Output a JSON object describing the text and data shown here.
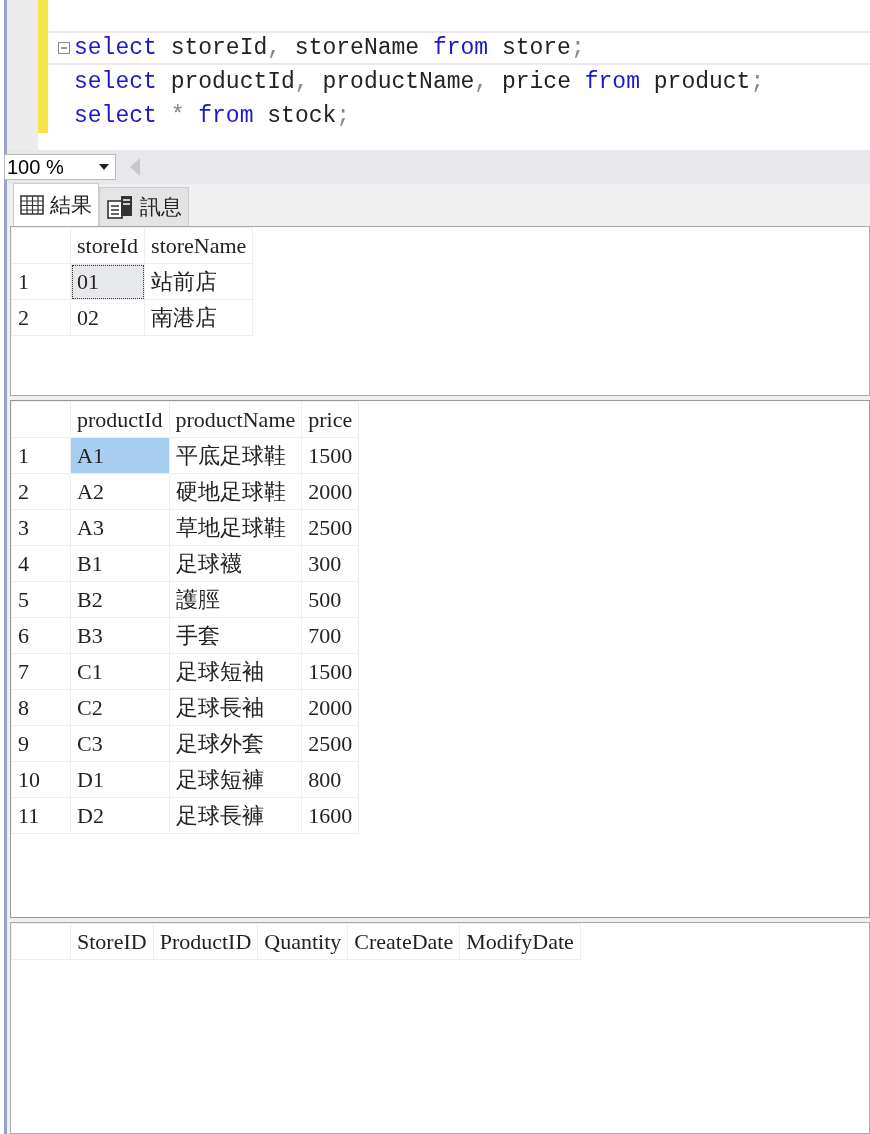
{
  "editor": {
    "lines": [
      [
        {
          "text": "select",
          "kind": "keyword"
        },
        {
          "text": " storeId",
          "kind": "ident"
        },
        {
          "text": ",",
          "kind": "punct"
        },
        {
          "text": " storeName ",
          "kind": "ident"
        },
        {
          "text": "from",
          "kind": "keyword"
        },
        {
          "text": " store",
          "kind": "ident"
        },
        {
          "text": ";",
          "kind": "punct"
        }
      ],
      [
        {
          "text": "select",
          "kind": "keyword"
        },
        {
          "text": " productId",
          "kind": "ident"
        },
        {
          "text": ",",
          "kind": "punct"
        },
        {
          "text": " productName",
          "kind": "ident"
        },
        {
          "text": ",",
          "kind": "punct"
        },
        {
          "text": " price ",
          "kind": "ident"
        },
        {
          "text": "from",
          "kind": "keyword"
        },
        {
          "text": " product",
          "kind": "ident"
        },
        {
          "text": ";",
          "kind": "punct"
        }
      ],
      [
        {
          "text": "select",
          "kind": "keyword"
        },
        {
          "text": " * ",
          "kind": "punct"
        },
        {
          "text": "from",
          "kind": "keyword"
        },
        {
          "text": " stock",
          "kind": "ident"
        },
        {
          "text": ";",
          "kind": "punct"
        }
      ]
    ]
  },
  "zoom": {
    "value": "100 %"
  },
  "tabs": [
    {
      "label": "結果",
      "selected": true
    },
    {
      "label": "訊息",
      "selected": false
    }
  ],
  "grids": [
    {
      "active": false,
      "columns": [
        "storeId",
        "storeName"
      ],
      "rows": [
        {
          "number": "1",
          "cells": [
            {
              "text": "01",
              "selected": true
            },
            {
              "text": "站前店",
              "selected": false
            }
          ]
        },
        {
          "number": "2",
          "cells": [
            {
              "text": "02",
              "selected": false
            },
            {
              "text": "南港店",
              "selected": false
            }
          ]
        }
      ]
    },
    {
      "active": true,
      "columns": [
        "productId",
        "productName",
        "price"
      ],
      "rows": [
        {
          "number": "1",
          "cells": [
            {
              "text": "A1",
              "selected": true
            },
            {
              "text": "平底足球鞋",
              "selected": false
            },
            {
              "text": "1500",
              "selected": false
            }
          ]
        },
        {
          "number": "2",
          "cells": [
            {
              "text": "A2",
              "selected": false
            },
            {
              "text": "硬地足球鞋",
              "selected": false
            },
            {
              "text": "2000",
              "selected": false
            }
          ]
        },
        {
          "number": "3",
          "cells": [
            {
              "text": "A3",
              "selected": false
            },
            {
              "text": "草地足球鞋",
              "selected": false
            },
            {
              "text": "2500",
              "selected": false
            }
          ]
        },
        {
          "number": "4",
          "cells": [
            {
              "text": "B1",
              "selected": false
            },
            {
              "text": "足球襪",
              "selected": false
            },
            {
              "text": "300",
              "selected": false
            }
          ]
        },
        {
          "number": "5",
          "cells": [
            {
              "text": "B2",
              "selected": false
            },
            {
              "text": "護脛",
              "selected": false
            },
            {
              "text": "500",
              "selected": false
            }
          ]
        },
        {
          "number": "6",
          "cells": [
            {
              "text": "B3",
              "selected": false
            },
            {
              "text": "手套",
              "selected": false
            },
            {
              "text": "700",
              "selected": false
            }
          ]
        },
        {
          "number": "7",
          "cells": [
            {
              "text": "C1",
              "selected": false
            },
            {
              "text": "足球短袖",
              "selected": false
            },
            {
              "text": "1500",
              "selected": false
            }
          ]
        },
        {
          "number": "8",
          "cells": [
            {
              "text": "C2",
              "selected": false
            },
            {
              "text": "足球長袖",
              "selected": false
            },
            {
              "text": "2000",
              "selected": false
            }
          ]
        },
        {
          "number": "9",
          "cells": [
            {
              "text": "C3",
              "selected": false
            },
            {
              "text": "足球外套",
              "selected": false
            },
            {
              "text": "2500",
              "selected": false
            }
          ]
        },
        {
          "number": "10",
          "cells": [
            {
              "text": "D1",
              "selected": false
            },
            {
              "text": "足球短褲",
              "selected": false
            },
            {
              "text": "800",
              "selected": false
            }
          ]
        },
        {
          "number": "11",
          "cells": [
            {
              "text": "D2",
              "selected": false
            },
            {
              "text": "足球長褲",
              "selected": false
            },
            {
              "text": "1600",
              "selected": false
            }
          ]
        }
      ]
    },
    {
      "columns": [
        "StoreID",
        "ProductID",
        "Quantity",
        "CreateDate",
        "ModifyDate"
      ]
    }
  ]
}
